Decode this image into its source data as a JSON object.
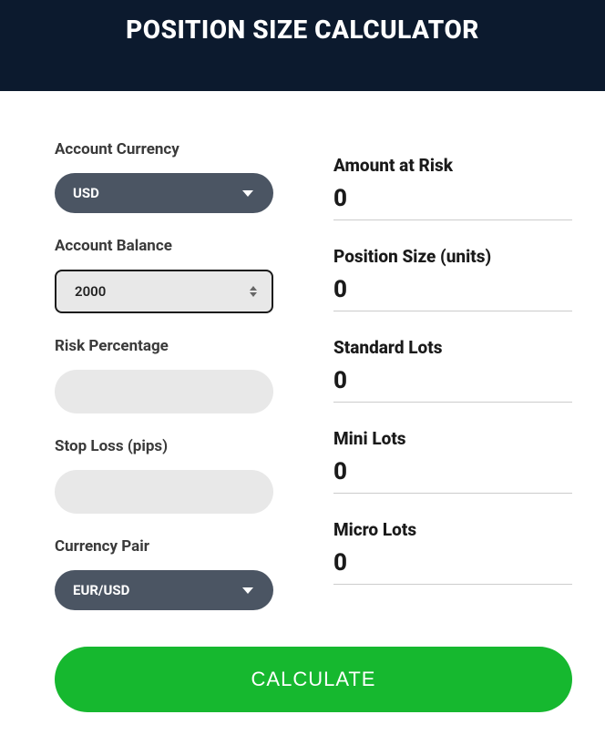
{
  "header": {
    "title": "POSITION SIZE CALCULATOR"
  },
  "inputs": {
    "account_currency": {
      "label": "Account Currency",
      "value": "USD"
    },
    "account_balance": {
      "label": "Account Balance",
      "value": "2000"
    },
    "risk_percentage": {
      "label": "Risk Percentage",
      "value": ""
    },
    "stop_loss": {
      "label": "Stop Loss (pips)",
      "value": ""
    },
    "currency_pair": {
      "label": "Currency Pair",
      "value": "EUR/USD"
    }
  },
  "results": {
    "amount_at_risk": {
      "label": "Amount at Risk",
      "value": "0"
    },
    "position_size": {
      "label": "Position Size (units)",
      "value": "0"
    },
    "standard_lots": {
      "label": "Standard Lots",
      "value": "0"
    },
    "mini_lots": {
      "label": "Mini Lots",
      "value": "0"
    },
    "micro_lots": {
      "label": "Micro Lots",
      "value": "0"
    }
  },
  "actions": {
    "calculate_label": "CALCULATE"
  }
}
